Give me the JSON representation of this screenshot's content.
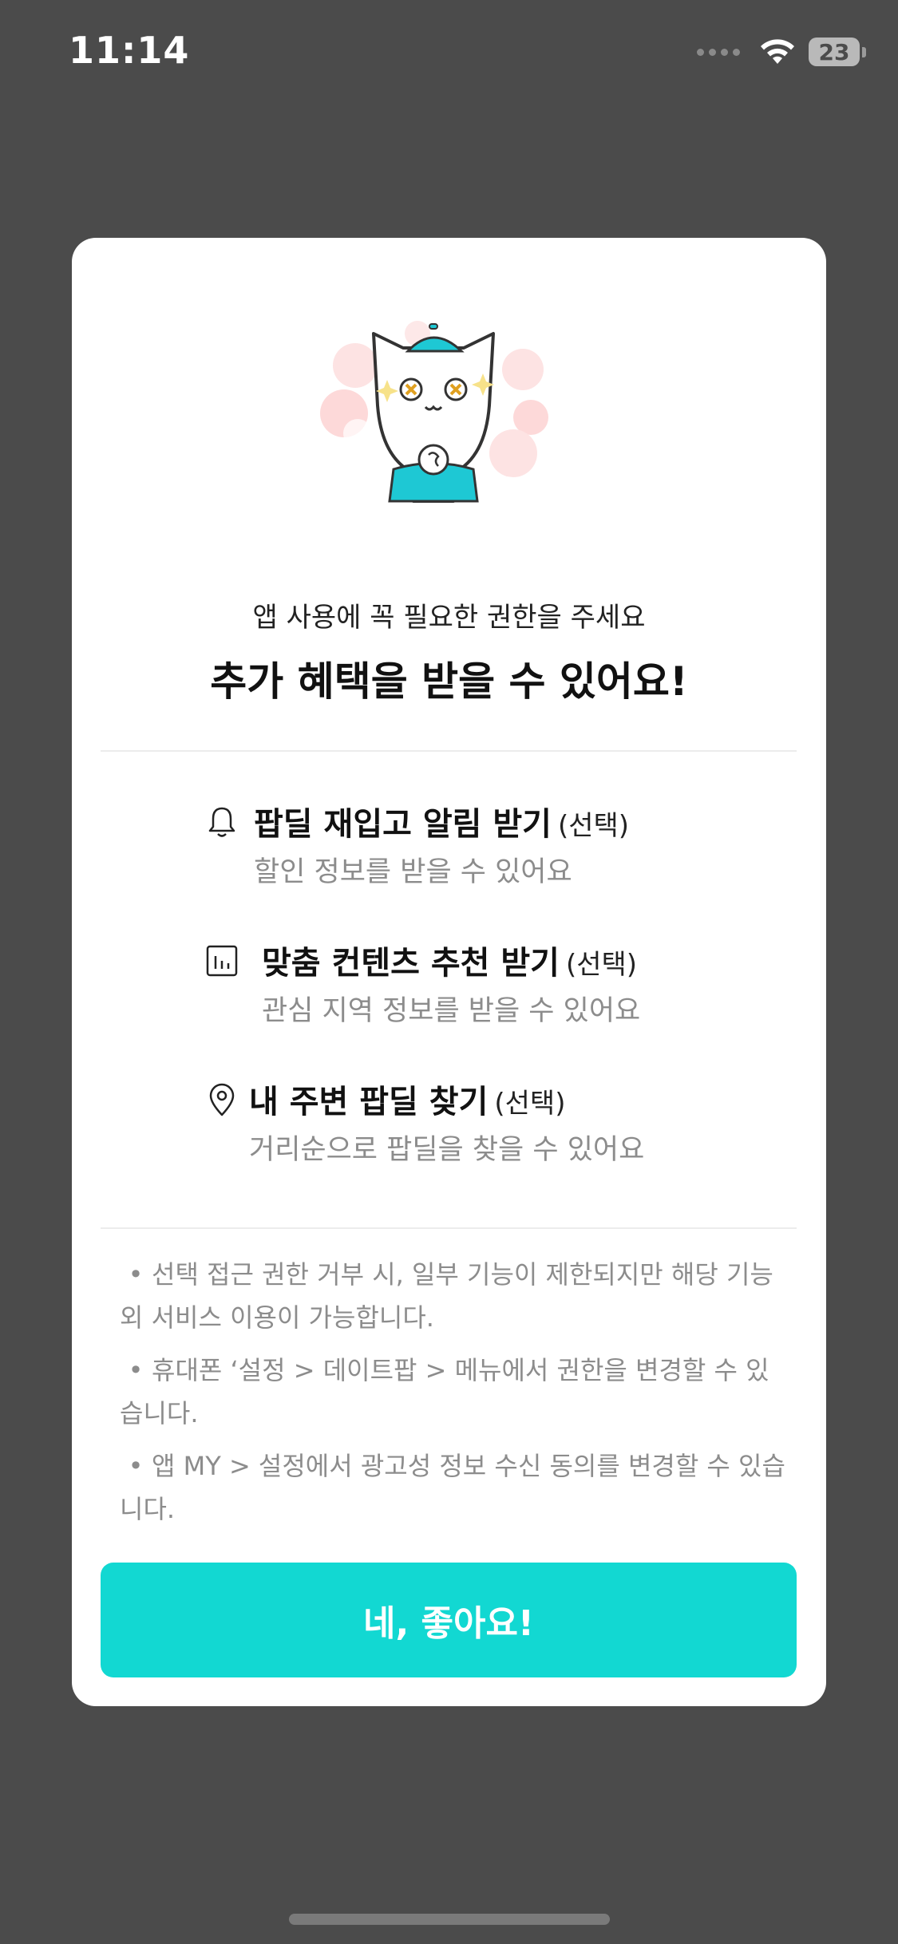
{
  "status_bar": {
    "time": "11:14",
    "battery": "23",
    "icons": [
      "cellular-signal-icon",
      "wifi-icon",
      "battery-icon"
    ]
  },
  "modal": {
    "mascot": "mascot-character-illustration",
    "subtitle": "앱 사용에 꼭 필요한 권한을 주세요",
    "headline": "추가 혜택을 받을 수 있어요!",
    "permissions": [
      {
        "icon": "bell-icon",
        "title": "팝딜 재입고 알림 받기",
        "optional": "(선택)",
        "description": "할인 정보를 받을 수 있어요"
      },
      {
        "icon": "chart-icon",
        "title": "맞춤 컨텐츠 추천 받기",
        "optional": "(선택)",
        "description": "관심 지역 정보를 받을 수 있어요"
      },
      {
        "icon": "location-pin-icon",
        "title": "내 주변 팝딜 찾기",
        "optional": "(선택)",
        "description": "거리순으로 팝딜을 찾을 수 있어요"
      }
    ],
    "notes": [
      "선택 접근 권한 거부 시, 일부 기능이 제한되지만 해당 기능 외 서비스 이용이 가능합니다.",
      "휴대폰 ‘설정 > 데이트팝 > 메뉴에서 권한을 변경할 수 있습니다.",
      "앱 MY > 설정에서 광고성 정보 수신 동의를 변경할 수 있습니다."
    ],
    "bullet": "•",
    "confirm_label": "네, 좋아요!"
  },
  "colors": {
    "backdrop": "#4b4b4b",
    "accent": "#12d8d2",
    "mascot_cap": "#1ec8d4",
    "muted_text": "#8c8c8c"
  }
}
